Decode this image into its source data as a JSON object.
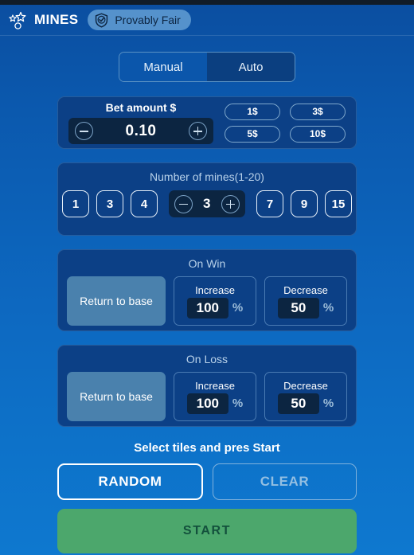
{
  "header": {
    "brand": "MINES",
    "logo_icon": "stars-icon",
    "fair_label": "Provably Fair",
    "fair_icon": "shield-check-icon"
  },
  "tabs": [
    {
      "label": "Manual",
      "active": false
    },
    {
      "label": "Auto",
      "active": true
    }
  ],
  "bet": {
    "label": "Bet amount $",
    "value": "0.10",
    "minus_icon": "minus-circle-icon",
    "plus_icon": "plus-circle-icon",
    "chips": [
      "1$",
      "3$",
      "5$",
      "10$"
    ]
  },
  "mines": {
    "title": "Number of mines(1-20)",
    "left_options": [
      "1",
      "3",
      "4"
    ],
    "right_options": [
      "7",
      "9",
      "15"
    ],
    "value": "3",
    "minus_icon": "minus-circle-icon",
    "plus_icon": "plus-circle-icon"
  },
  "on_win": {
    "title": "On Win",
    "return_to_base": "Return to base",
    "increase_label": "Increase",
    "increase_value": "100",
    "decrease_label": "Decrease",
    "decrease_value": "50",
    "percent_sign": "%"
  },
  "on_loss": {
    "title": "On Loss",
    "return_to_base": "Return to base",
    "increase_label": "Increase",
    "increase_value": "100",
    "decrease_label": "Decrease",
    "decrease_value": "50",
    "percent_sign": "%"
  },
  "bottom": {
    "hint": "Select tiles and pres Start",
    "random_label": "RANDOM",
    "clear_label": "CLEAR",
    "start_label": "START"
  },
  "colors": {
    "background_top": "#0b4ea0",
    "background_bottom": "#0e78cf",
    "panel": "#0c4086",
    "input_dark": "#0c2541",
    "tab_active": "#0b3f80",
    "return_base": "#4a81ad",
    "start_green": "#4ca76c",
    "start_text": "#13503c",
    "chip_border": "#7fa8cc"
  }
}
